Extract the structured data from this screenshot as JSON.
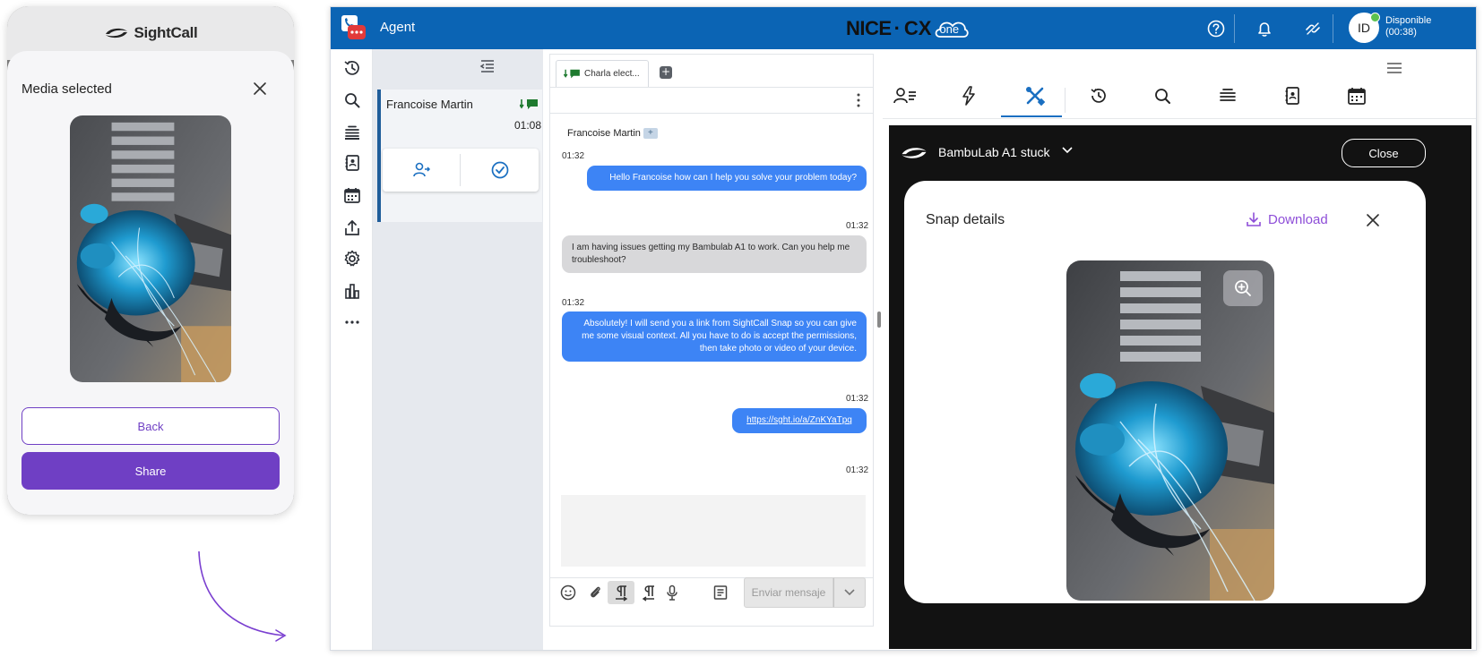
{
  "phone": {
    "brand": "SightCall",
    "sheet_title": "Media selected",
    "back_label": "Back",
    "share_label": "Share"
  },
  "app": {
    "title": "Agent",
    "brand": {
      "nice": "NICE",
      "dot": "·",
      "cx": "CX",
      "one": "one"
    },
    "user": {
      "initials": "ID",
      "status": "Disponible",
      "timer": "(00:38)"
    }
  },
  "contacts": {
    "items": [
      {
        "name": "Francoise Martin",
        "time": "01:08"
      }
    ]
  },
  "chat": {
    "tab_label": "Charla elect...",
    "from": "Francoise Martin",
    "from_badge": "+",
    "messages": [
      {
        "time": "01:32",
        "text": "Hello Francoise how can I help you solve your problem today?",
        "dir": "out"
      },
      {
        "time": "01:32",
        "text": "I am having issues getting my Bambulab A1 to work. Can you help me troubleshoot?",
        "dir": "in"
      },
      {
        "time": "01:32",
        "text": "Absolutely! I will send you a link from SightCall Snap so you can give me some visual context. All you have to do is accept the permissions, then take photo or video of your device.",
        "dir": "out"
      },
      {
        "time": "01:32",
        "text": "https://sght.io/a/ZnKYaTpq",
        "dir": "out"
      }
    ],
    "last_time": "01:32",
    "send_label": "Enviar mensaje"
  },
  "snap": {
    "title": "BambuLab A1 stuck",
    "close_label": "Close",
    "details_title": "Snap details",
    "download_label": "Download"
  },
  "colors": {
    "topbar": "#0b64b4",
    "accent_purple": "#6f3fc4",
    "bubble_out": "#3d84f5",
    "bubble_in": "#d8d8da",
    "snap_bg": "#121212"
  }
}
